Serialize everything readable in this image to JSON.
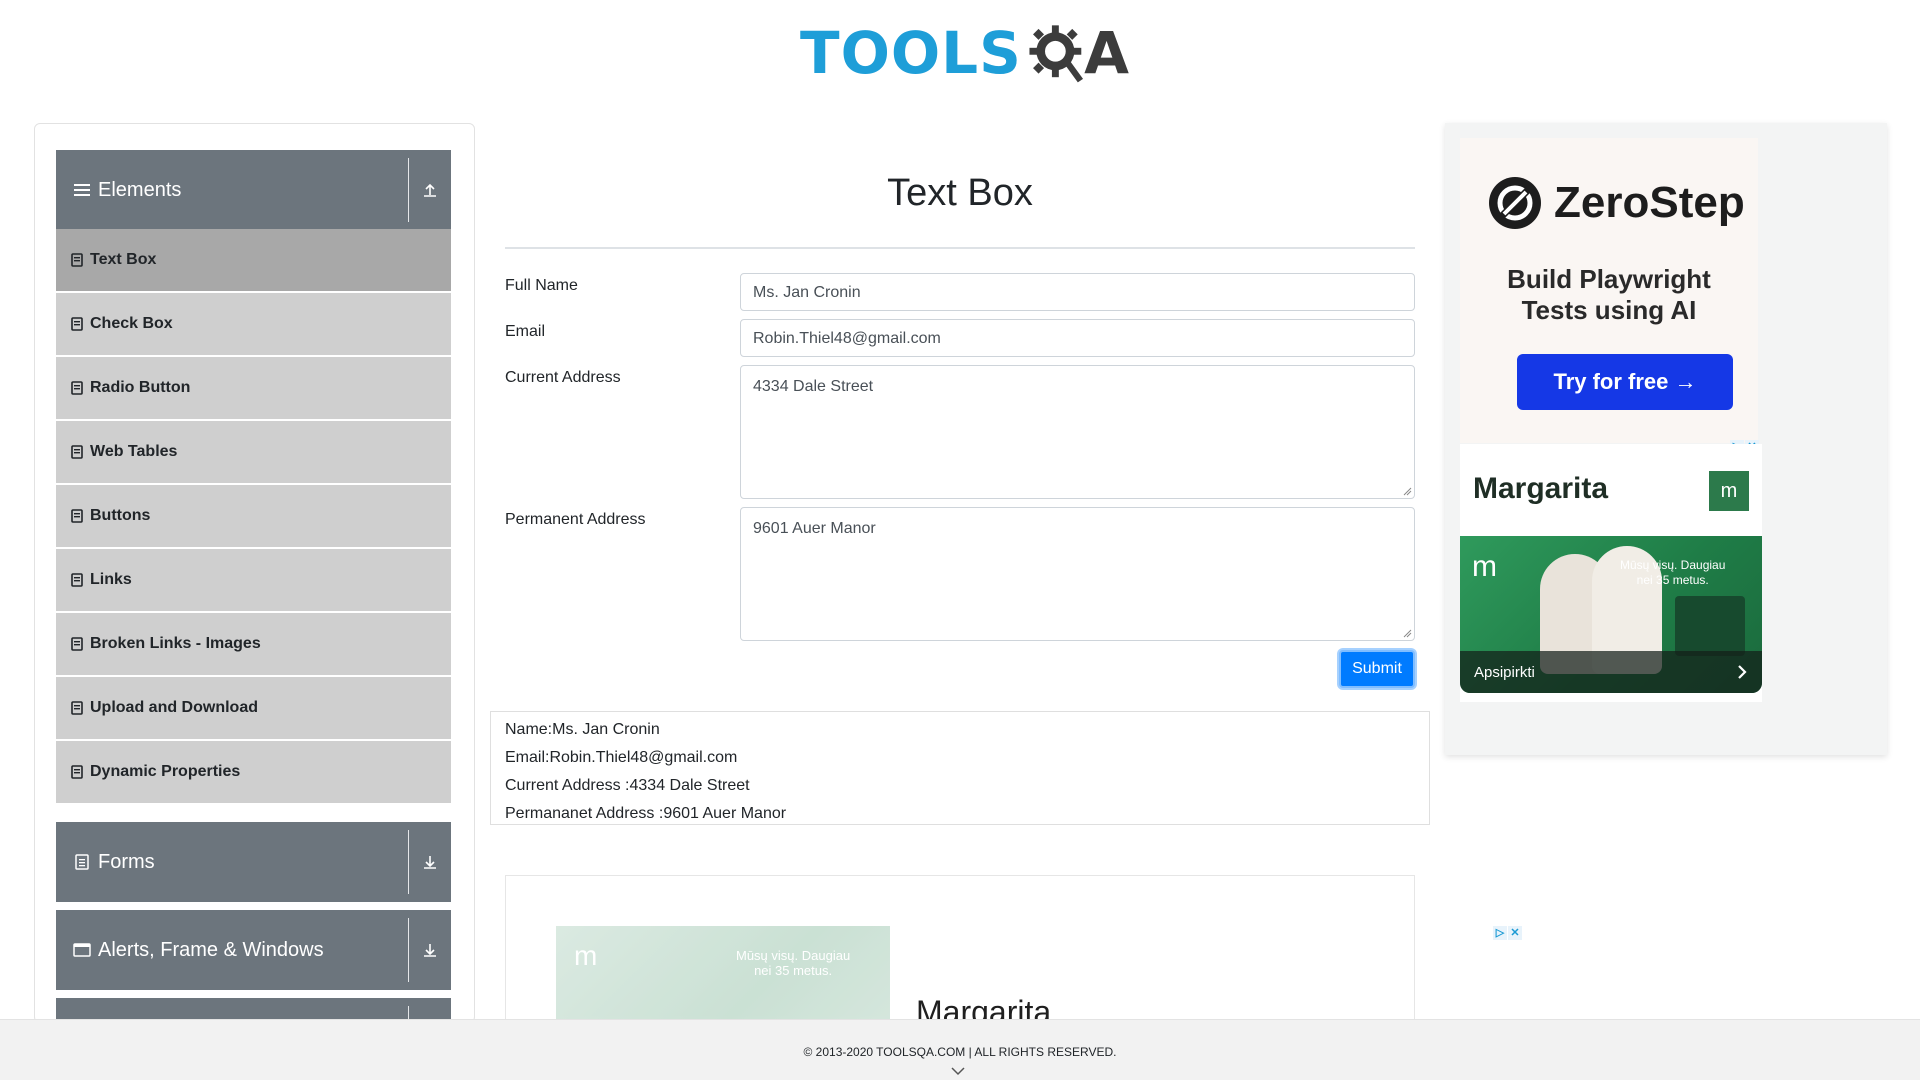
{
  "header": {
    "logo_text_tools": "TOOLS",
    "logo_text_qa": "A"
  },
  "sidebar": {
    "groups": [
      {
        "label": "Elements",
        "icon": "hamburger-icon",
        "state": "expanded"
      },
      {
        "label": "Forms",
        "icon": "document-icon",
        "state": "collapsed"
      },
      {
        "label": "Alerts, Frame & Windows",
        "icon": "window-icon",
        "state": "collapsed"
      }
    ],
    "items": [
      {
        "label": "Text Box",
        "active": true
      },
      {
        "label": "Check Box"
      },
      {
        "label": "Radio Button"
      },
      {
        "label": "Web Tables"
      },
      {
        "label": "Buttons"
      },
      {
        "label": "Links"
      },
      {
        "label": "Broken Links - Images"
      },
      {
        "label": "Upload and Download"
      },
      {
        "label": "Dynamic Properties"
      }
    ]
  },
  "main": {
    "title": "Text Box",
    "form": {
      "full_name": {
        "label": "Full Name",
        "value": "Ms. Jan Cronin"
      },
      "email": {
        "label": "Email",
        "value": "Robin.Thiel48@gmail.com"
      },
      "current_address": {
        "label": "Current Address",
        "value": "4334 Dale Street"
      },
      "permanent_address": {
        "label": "Permanent Address",
        "value": "9601 Auer Manor"
      },
      "submit_label": "Submit"
    },
    "output": {
      "name": "Name:Ms. Jan Cronin",
      "email": "Email:Robin.Thiel48@gmail.com",
      "current_address": "Current Address :4334 Dale Street",
      "permanent_address": "Permananet Address :9601 Auer Manor"
    }
  },
  "right_ad": {
    "brand": "ZeroStep",
    "tagline_line1": "Build Playwright",
    "tagline_line2": "Tests using AI",
    "cta": "Try for free →",
    "second_brand": "Margarita",
    "second_image_text_line1": "Mūsų visų. Daugiau",
    "second_image_text_line2": "nei 35 metus.",
    "second_cta": "Apsipirkti",
    "second_logo_caption": "margarita"
  },
  "lower_ad": {
    "brand": "Margarita",
    "image_text_line1": "Mūsų visų. Daugiau",
    "image_text_line2": "nei 35 metus.",
    "logo_caption": "margarita"
  },
  "footer": {
    "copyright": "© 2013-2020 TOOLSQA.COM | ALL RIGHTS RESERVED."
  },
  "colors": {
    "accent": "#007bff",
    "sidebar_header": "#6c757d",
    "sidebar_item": "#cfcfcf",
    "sidebar_item_active": "#a8a8a8",
    "logo_blue": "#1e9ed8",
    "zerostep_button": "#1538e6"
  }
}
